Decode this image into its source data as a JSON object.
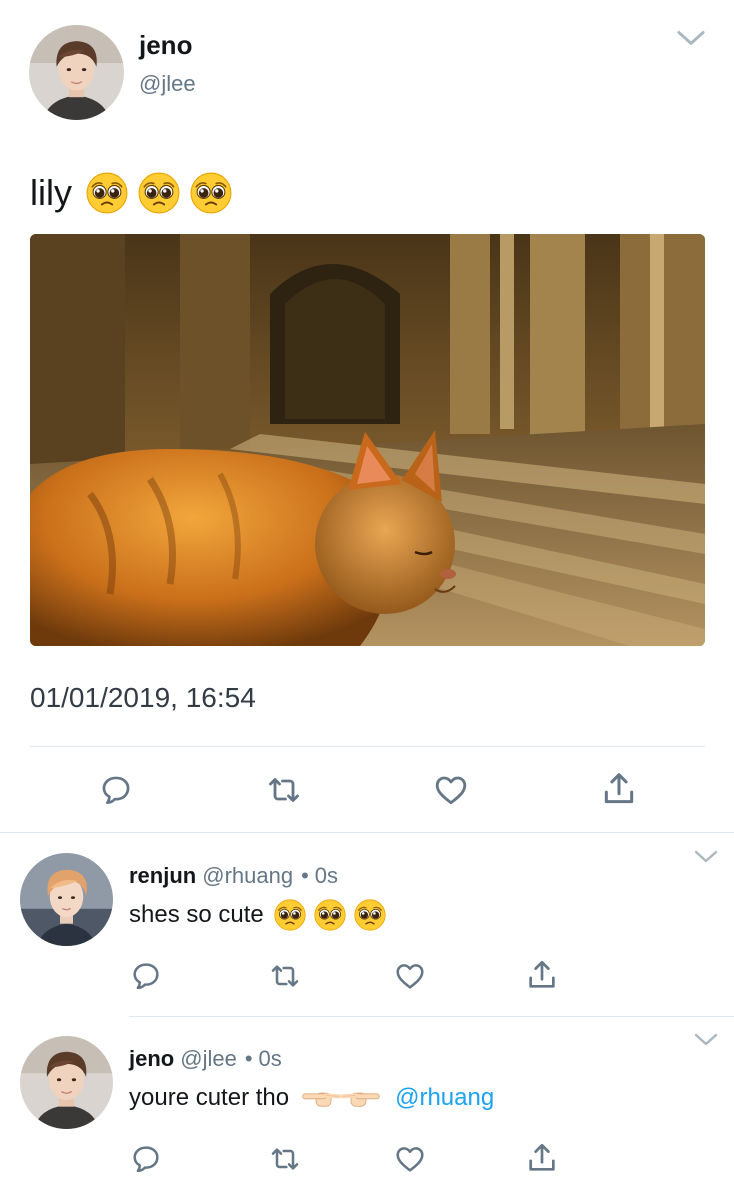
{
  "tweet": {
    "author_name": "jeno",
    "author_handle": "@jlee",
    "text": "lily",
    "text_emojis": [
      "pleading-face",
      "pleading-face",
      "pleading-face"
    ],
    "timestamp": "01/01/2019, 16:54",
    "media_description": "orange cat in sunlit corridor"
  },
  "replies": [
    {
      "name": "renjun",
      "handle": "@rhuang",
      "separator": "•",
      "time": "0s",
      "text": "shes so cute",
      "emojis": [
        "pleading-face",
        "pleading-face",
        "pleading-face"
      ]
    },
    {
      "name": "jeno",
      "handle": "@jlee",
      "separator": "•",
      "time": "0s",
      "text": "youre cuter tho",
      "emojis": [
        "pointing-right",
        "pointing-left"
      ],
      "mention": "@rhuang"
    }
  ],
  "icons": {
    "reply": "reply-icon",
    "retweet": "retweet-icon",
    "like": "heart-icon",
    "share": "share-icon",
    "menu": "chevron-down-icon"
  },
  "colors": {
    "text": "#14171a",
    "secondary": "#657786",
    "link": "#1da1f2",
    "icon": "#657786",
    "divider": "#e1e8ed"
  }
}
